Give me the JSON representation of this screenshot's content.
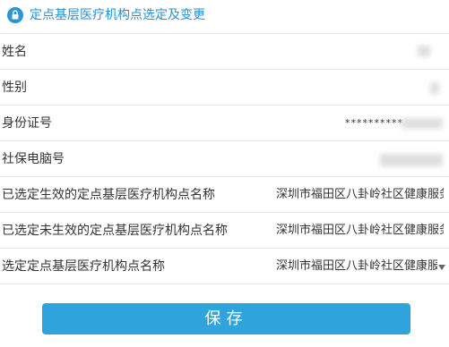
{
  "header": {
    "title": "定点基层医疗机构点选定及变更",
    "icon": "lock-icon",
    "color": "#2b8fd2"
  },
  "fields": [
    {
      "label": "姓名",
      "value": "",
      "value_redacted": true
    },
    {
      "label": "性别",
      "value": "",
      "value_redacted": true
    },
    {
      "label": "身份证号",
      "value": "**********",
      "value_redacted": true
    },
    {
      "label": "社保电脑号",
      "value": "",
      "value_redacted": true
    },
    {
      "label": "已选定生效的定点基层医疗机构点名称",
      "value": "深圳市福田区八卦岭社区健康服务中心"
    },
    {
      "label": "已选定未生效的定点基层医疗机构点名称",
      "value": "深圳市福田区八卦岭社区健康服务中心"
    },
    {
      "label": "选定定点基层医疗机构点名称",
      "value": "深圳市福田区八卦岭社区健康服务中心",
      "control": "select"
    }
  ],
  "actions": {
    "save_label": "保存",
    "button_color": "#2ea3dc"
  }
}
